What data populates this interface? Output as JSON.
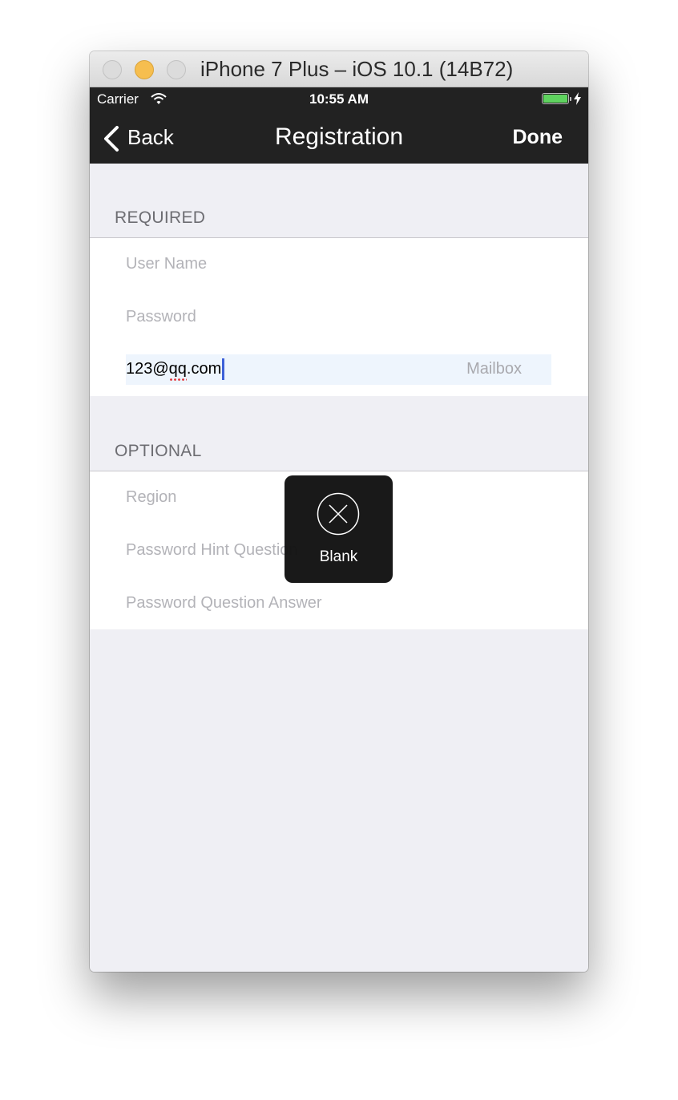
{
  "window": {
    "title": "iPhone 7 Plus – iOS 10.1 (14B72)"
  },
  "status_bar": {
    "carrier": "Carrier",
    "time": "10:55 AM",
    "battery_level": 1.0
  },
  "nav": {
    "back_label": "Back",
    "title": "Registration",
    "done_label": "Done"
  },
  "required": {
    "header": "REQUIRED",
    "user_name_placeholder": "User Name",
    "password_placeholder": "Password",
    "email_value": "123@qq.com",
    "email_trailing_label": "Mailbox"
  },
  "optional": {
    "header": "OPTIONAL",
    "region_placeholder": "Region",
    "hint_question_placeholder": "Password Hint Question",
    "answer_placeholder": "Password Question Answer"
  },
  "hud": {
    "label": "Blank",
    "icon": "x-circle-icon"
  },
  "colors": {
    "bar_bg": "#222222",
    "list_bg": "#efeff4",
    "caret": "#3e61d8",
    "battery": "#5fd35f"
  }
}
